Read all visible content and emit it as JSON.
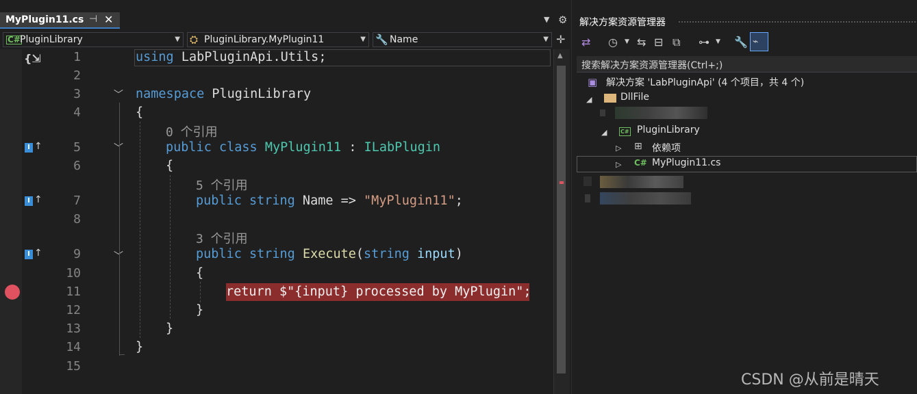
{
  "editor_tab": {
    "title": "MyPlugin11.cs",
    "pin_glyph": "⊣",
    "close_glyph": "✕"
  },
  "navbar": {
    "project": "PluginLibrary",
    "class": "PluginLibrary.MyPlugin11",
    "member": "Name"
  },
  "code_lines": {
    "1": [
      "using",
      " LabPluginApi.Utils;"
    ],
    "3": [
      "namespace",
      " PluginLibrary"
    ],
    "4": "{",
    "5": [
      "public",
      " ",
      "class",
      " ",
      "MyPlugin11",
      " : ",
      "ILabPlugin"
    ],
    "6": "{",
    "7": [
      "public",
      " ",
      "string",
      " Name => ",
      "\"MyPlugin11\"",
      ";"
    ],
    "9": [
      "public",
      " ",
      "string",
      " ",
      "Execute",
      "(",
      "string",
      " ",
      "input",
      ")"
    ],
    "10": "{",
    "11": "return $\"{input} processed by MyPlugin\";",
    "12": "}",
    "13": "}",
    "14": "}"
  },
  "line_numbers": [
    "1",
    "2",
    "3",
    "4",
    "5",
    "6",
    "7",
    "8",
    "9",
    "10",
    "11",
    "12",
    "13",
    "14",
    "15"
  ],
  "codelens": {
    "class": "0 个引用",
    "name": "5 个引用",
    "execute": "3 个引用"
  },
  "solution_explorer": {
    "title": "解决方案资源管理器",
    "search_placeholder": "搜索解决方案资源管理器(Ctrl+;)",
    "solution": "解决方案 'LabPluginApi' (4 个项目，共 4 个)",
    "items": [
      {
        "label": "DllFile",
        "icon": "folder-icon"
      },
      {
        "label": "PluginLibrary",
        "icon": "csharp-project-icon"
      },
      {
        "label": "依赖项",
        "icon": "dependencies-icon"
      },
      {
        "label": "MyPlugin11.cs",
        "icon": "csharp-file-icon"
      }
    ]
  },
  "colors": {
    "keyword": "#569cd6",
    "type": "#4ec9b0",
    "method": "#dcdcaa",
    "string": "#d69d85",
    "breakpoint": "#e0525f",
    "breakpoint_line": "#8b2d2d"
  },
  "watermark": "CSDN @从前是晴天"
}
